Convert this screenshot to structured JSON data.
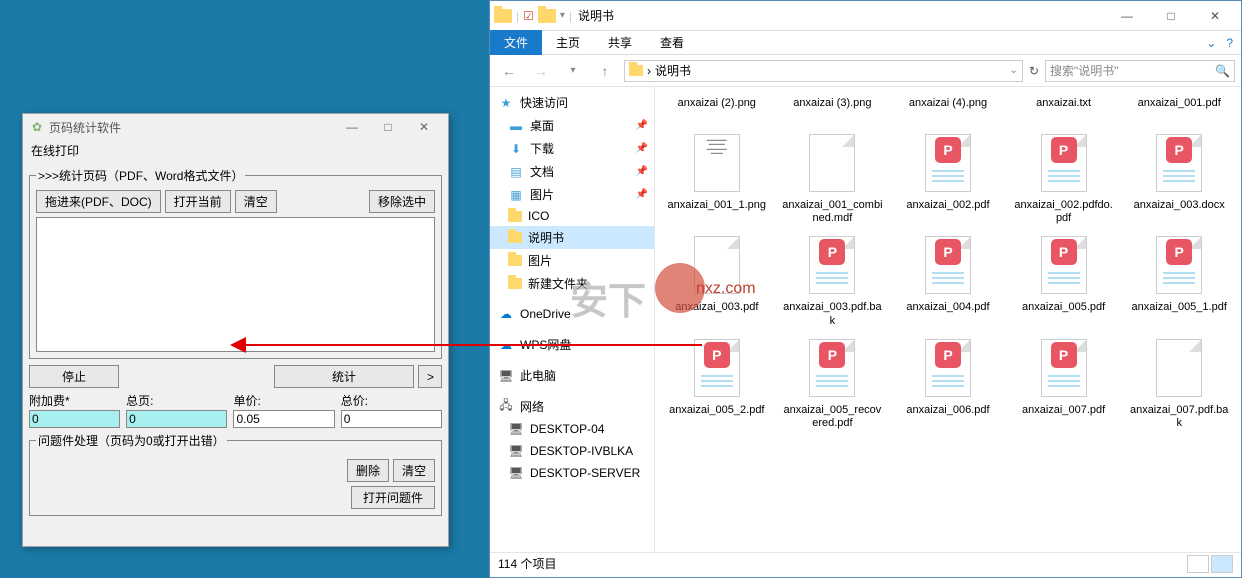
{
  "app": {
    "title": "页码统计软件",
    "subheader": "在线打印",
    "fieldset1_legend": ">>>统计页码（PDF、Word格式文件）",
    "btn_drag": "拖进来(PDF、DOC)",
    "btn_open": "打开当前",
    "btn_clear": "清空",
    "btn_remove_sel": "移除选中",
    "btn_stop": "停止",
    "btn_stat": "统计",
    "btn_more": ">",
    "field_fee": "附加费*",
    "field_total_pages": "总页:",
    "field_unit_price": "单价:",
    "field_total_price": "总价:",
    "val_fee": "0",
    "val_total_pages": "0",
    "val_unit_price": "0.05",
    "val_total_price": "0",
    "fieldset2_legend": "问题件处理（页码为0或打开出错）",
    "btn_delete": "删除",
    "btn_clear2": "清空",
    "btn_open_problem": "打开问题件",
    "min": "—",
    "max": "□",
    "close": "✕"
  },
  "explorer": {
    "title": "说明书",
    "ribbon": {
      "file": "文件",
      "home": "主页",
      "share": "共享",
      "view": "查看"
    },
    "addr": "说明书",
    "addr_sep": "›",
    "search_placeholder": "搜索\"说明书\"",
    "refresh_icon": "↻",
    "nav": {
      "quick": "快速访问",
      "desktop": "桌面",
      "downloads": "下载",
      "documents": "文档",
      "pictures": "图片",
      "ico": "ICO",
      "manual": "说明书",
      "pictures2": "图片",
      "newfolder": "新建文件夹",
      "onedrive": "OneDrive",
      "wps": "WPS网盘",
      "thispc": "此电脑",
      "network": "网络",
      "pc1": "DESKTOP-04",
      "pc2": "DESKTOP-IVBLKA",
      "pc3": "DESKTOP-SERVER"
    },
    "files": [
      {
        "name": "anxaizai (2).png",
        "type": "img"
      },
      {
        "name": "anxaizai (3).png",
        "type": "img"
      },
      {
        "name": "anxaizai (4).png",
        "type": "pdf"
      },
      {
        "name": "anxaizai.txt",
        "type": "pdf"
      },
      {
        "name": "anxaizai_001.pdf",
        "type": "doc"
      },
      {
        "name": "anxaizai_001_1.png",
        "type": "img-content"
      },
      {
        "name": "anxaizai_001_combined.mdf",
        "type": "blank"
      },
      {
        "name": "anxaizai_002.pdf",
        "type": "pdf"
      },
      {
        "name": "anxaizai_002.pdfdo.pdf",
        "type": "pdf"
      },
      {
        "name": "anxaizai_003.docx",
        "type": "pdf"
      },
      {
        "name": "anxaizai_003.pdf",
        "type": "blank"
      },
      {
        "name": "anxaizai_003.pdf.bak",
        "type": "pdf"
      },
      {
        "name": "anxaizai_004.pdf",
        "type": "pdf"
      },
      {
        "name": "anxaizai_005.pdf",
        "type": "pdf"
      },
      {
        "name": "anxaizai_005_1.pdf",
        "type": "pdf"
      },
      {
        "name": "anxaizai_005_2.pdf",
        "type": "pdf"
      },
      {
        "name": "anxaizai_005_recovered.pdf",
        "type": "pdf"
      },
      {
        "name": "anxaizai_006.pdf",
        "type": "pdf"
      },
      {
        "name": "anxaizai_007.pdf",
        "type": "pdf"
      },
      {
        "name": "anxaizai_007.pdf.bak",
        "type": "blank"
      }
    ],
    "status": "114 个项目"
  },
  "watermark": "安下"
}
